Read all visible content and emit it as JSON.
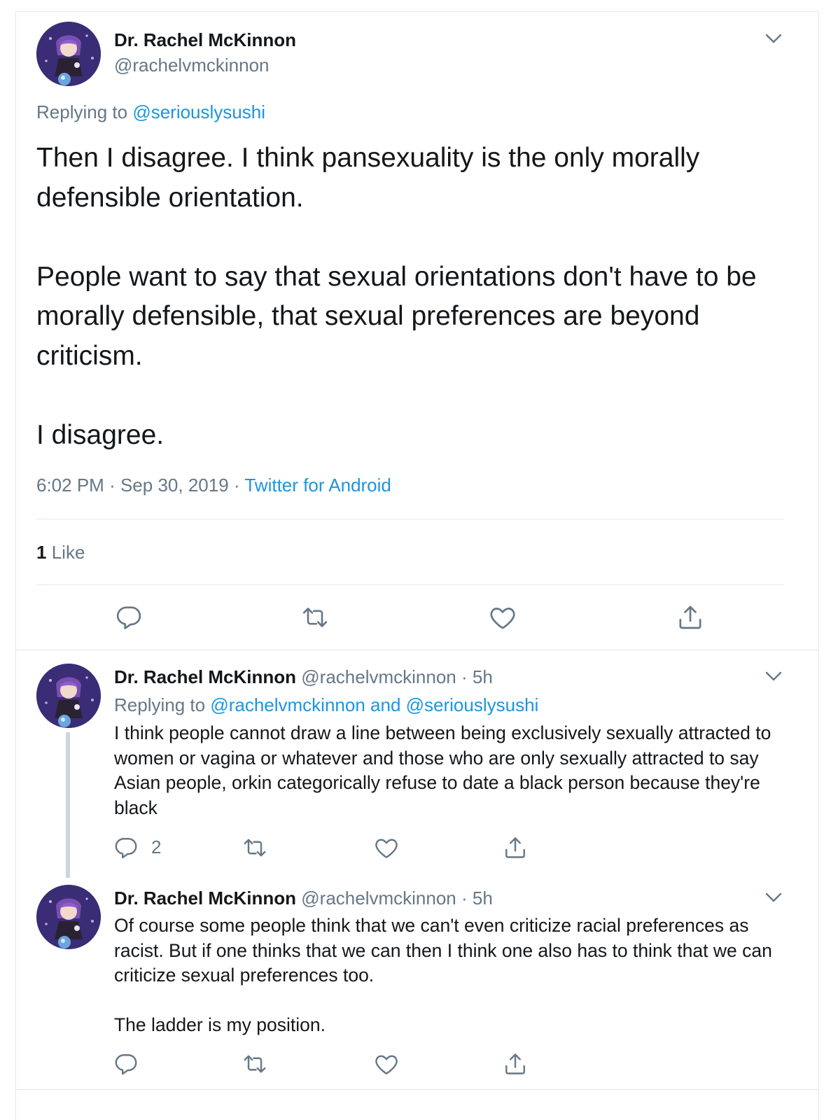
{
  "main_tweet": {
    "author_name": "Dr. Rachel McKinnon",
    "author_handle": "@rachelvmckinnon",
    "replying_prefix": "Replying to",
    "replying_to": "@seriouslysushi",
    "paragraphs": [
      "Then I disagree. I think pansexuality is the only morally defensible orientation.",
      "People want to say that sexual orientations don't have to be morally defensible, that sexual preferences are beyond criticism.",
      "I disagree."
    ],
    "time": "6:02 PM",
    "date": "Sep 30, 2019",
    "source": "Twitter for Android",
    "like_count": "1",
    "like_label": "Like"
  },
  "replies": [
    {
      "author_name": "Dr. Rachel McKinnon",
      "author_handle": "@rachelvmckinnon",
      "age": "5h",
      "replying_prefix": "Replying to",
      "replying_to": "@rachelvmckinnon and @seriouslysushi",
      "paragraphs": [
        "I think people cannot draw a line between being exclusively sexually attracted to women or vagina or whatever and those who are only sexually attracted to say Asian people, orkin categorically refuse to date a black person because they're black"
      ],
      "reply_count": "2"
    },
    {
      "author_name": "Dr. Rachel McKinnon",
      "author_handle": "@rachelvmckinnon",
      "age": "5h",
      "paragraphs": [
        "Of course some people think that we can't even criticize racial preferences as racist. But if one thinks that we can then I think one also has to think that we can criticize sexual preferences too.",
        "The ladder is my position."
      ]
    }
  ],
  "separator": "·",
  "icons": {
    "reply": "reply-icon",
    "retweet": "retweet-icon",
    "like": "heart-icon",
    "share": "share-icon",
    "more": "chevron-down-icon"
  },
  "colors": {
    "link": "#1b95e0",
    "secondary": "#657786",
    "text": "#14171a",
    "border": "#e1e8ed"
  }
}
